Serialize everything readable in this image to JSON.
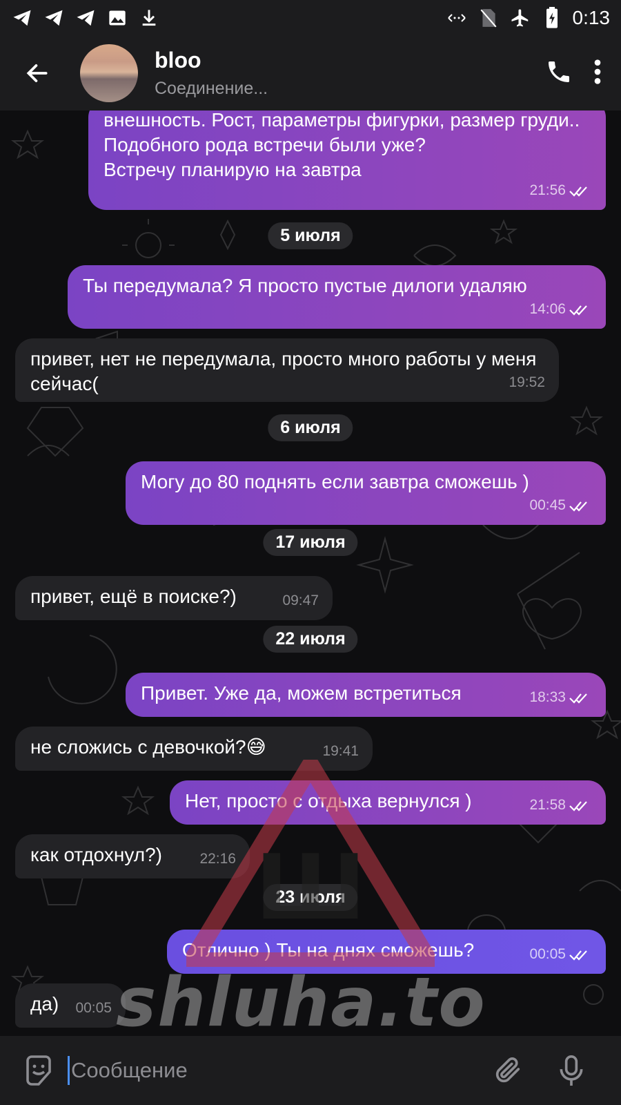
{
  "status_bar": {
    "time": "0:13",
    "left_icons": [
      "telegram-icon",
      "telegram-icon",
      "telegram-icon",
      "image-icon",
      "download-icon"
    ],
    "right_icons": [
      "data-arrows-icon",
      "no-sim-icon",
      "airplane-icon",
      "battery-charging-icon"
    ]
  },
  "header": {
    "title": "bloo",
    "subtitle": "Соединение..."
  },
  "messages": [
    {
      "dir": "out",
      "text": "внешность. Рост, параметры фигурки, размер груди..\nПодобного рода встречи были уже?\nВстречу планирую на завтра",
      "time": "21:56"
    },
    {
      "date": "5 июля"
    },
    {
      "dir": "out",
      "text": "Ты передумала? Я просто пустые дилоги удаляю",
      "time": "14:06"
    },
    {
      "dir": "in",
      "text": "привет, нет не передумала, просто много работы у меня сейчас(",
      "time": "19:52"
    },
    {
      "date": "6 июля"
    },
    {
      "dir": "out",
      "text": "Могу до 80 поднять если завтра сможешь )",
      "time": "00:45"
    },
    {
      "date": "17 июля"
    },
    {
      "dir": "in",
      "text": "привет, ещё в поиске?)",
      "time": "09:47"
    },
    {
      "date": "22 июля"
    },
    {
      "dir": "out",
      "text": "Привет. Уже да, можем встретиться",
      "time": "18:33"
    },
    {
      "dir": "in",
      "text": "не сложись с девочкой?😅",
      "time": "19:41"
    },
    {
      "dir": "out",
      "text": "Нет, просто с отдыха вернулся )",
      "time": "21:58"
    },
    {
      "dir": "in",
      "text": "как отдохнул?)",
      "time": "22:16"
    },
    {
      "date": "23 июля"
    },
    {
      "dir": "out",
      "text": "Отлично ) Ты на днях сможешь?",
      "time": "00:05"
    },
    {
      "dir": "in",
      "text": "да)",
      "time": "00:05"
    }
  ],
  "input": {
    "placeholder": "Сообщение"
  },
  "watermark": {
    "text": "shluha.to",
    "logo_letter": "Ш"
  },
  "colors": {
    "outgoing_bubble": "#8a46c0",
    "incoming_bubble": "#232326",
    "accent": "#4b8ff0"
  }
}
